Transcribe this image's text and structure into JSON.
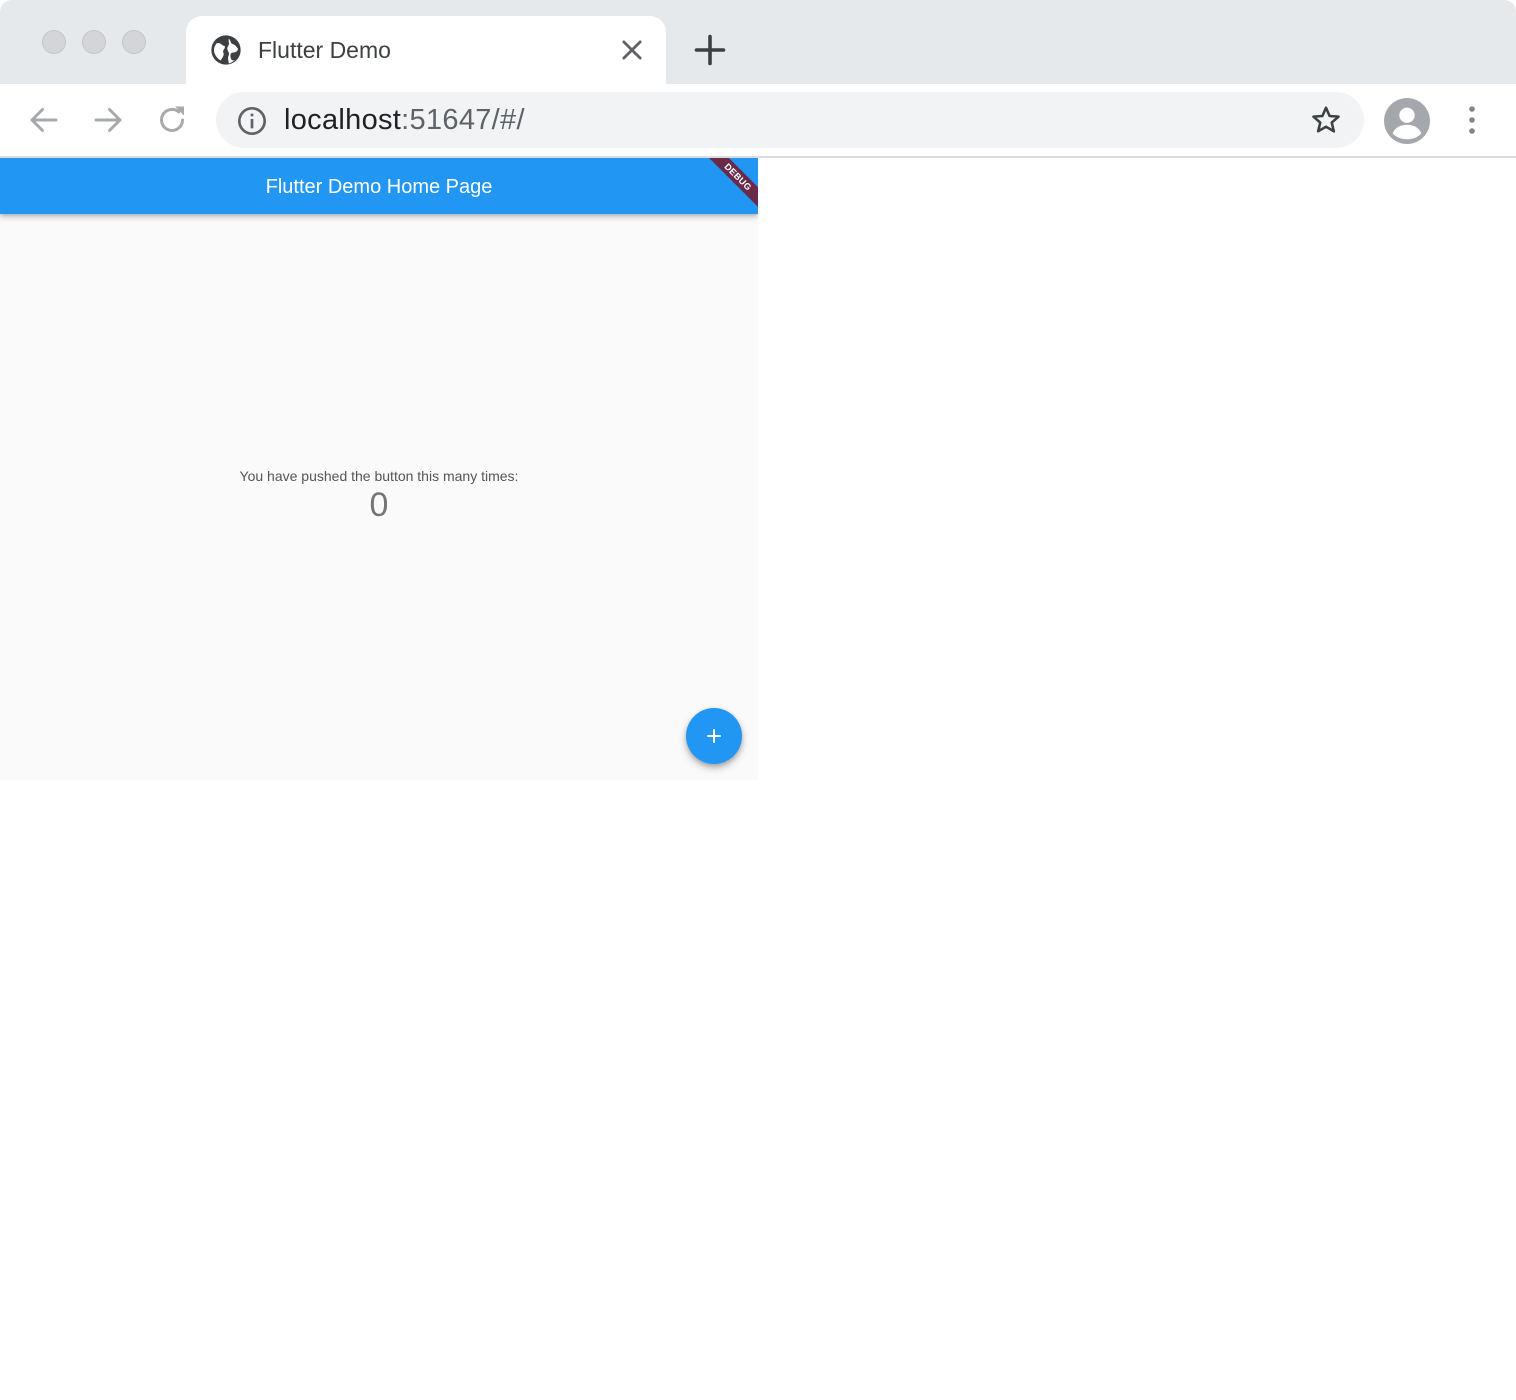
{
  "browser": {
    "tab": {
      "title": "Flutter Demo",
      "favicon": "globe-icon"
    },
    "address_bar": {
      "host": "localhost",
      "rest": ":51647/#/"
    },
    "colors": {
      "chrome_bg": "#e6e9ec",
      "omnibox_bg": "#f1f3f4"
    }
  },
  "app": {
    "appbar": {
      "title": "Flutter Demo Home Page",
      "color": "#2196f3"
    },
    "debug_banner": "DEBUG",
    "counter": {
      "label": "You have pushed the button this many times:",
      "value": "0"
    },
    "fab": {
      "icon": "add-icon",
      "color": "#2196f3"
    }
  }
}
